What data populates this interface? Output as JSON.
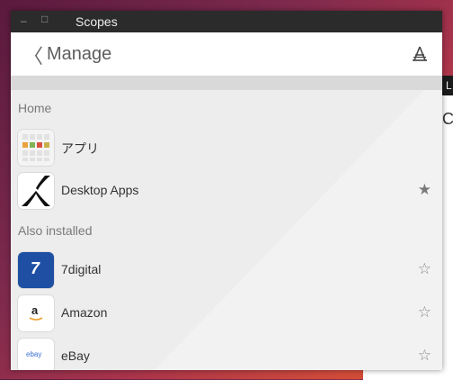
{
  "window": {
    "title": "Scopes"
  },
  "header": {
    "back_symbol": "〈",
    "title": "Manage",
    "store_icon": "store-icon"
  },
  "sections": {
    "home": "Home",
    "also_installed": "Also installed"
  },
  "home_items": [
    {
      "label": "アプリ",
      "icon": "apps-grid-icon",
      "favorite": false,
      "star": ""
    },
    {
      "label": "Desktop Apps",
      "icon": "x-logo-icon",
      "favorite": true,
      "star": "★"
    }
  ],
  "installed_items": [
    {
      "label": "7digital",
      "icon": "7digital-icon",
      "favorite": false,
      "star": "☆",
      "icon_text": "7"
    },
    {
      "label": "Amazon",
      "icon": "amazon-icon",
      "favorite": false,
      "star": "☆",
      "icon_text": "a"
    },
    {
      "label": "eBay",
      "icon": "ebay-icon",
      "favorite": false,
      "star": "☆",
      "icon_text": "ebay"
    }
  ],
  "background_window": {
    "title_fragment": "L",
    "text_fragment": "C"
  },
  "colors": {
    "accent_blue": "#1e4fa3",
    "titlebar": "#2b2b2b"
  }
}
